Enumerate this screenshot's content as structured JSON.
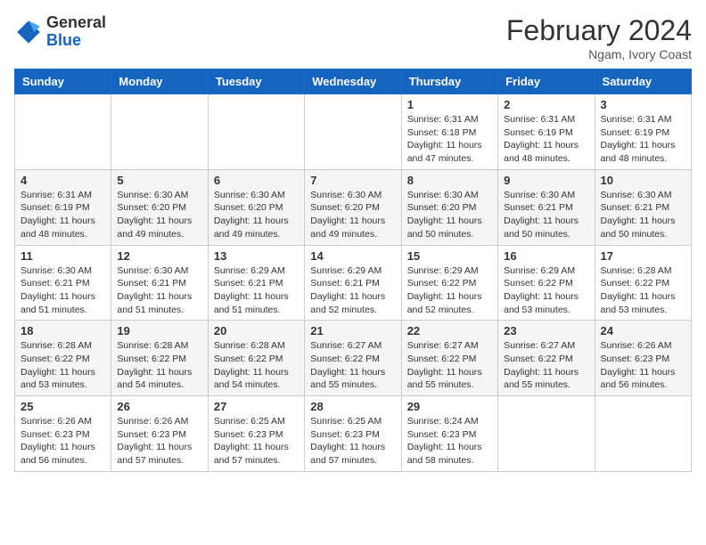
{
  "header": {
    "logo_general": "General",
    "logo_blue": "Blue",
    "month_title": "February 2024",
    "subtitle": "Ngam, Ivory Coast"
  },
  "columns": [
    "Sunday",
    "Monday",
    "Tuesday",
    "Wednesday",
    "Thursday",
    "Friday",
    "Saturday"
  ],
  "weeks": [
    [
      {
        "day": "",
        "info": ""
      },
      {
        "day": "",
        "info": ""
      },
      {
        "day": "",
        "info": ""
      },
      {
        "day": "",
        "info": ""
      },
      {
        "day": "1",
        "info": "Sunrise: 6:31 AM\nSunset: 6:18 PM\nDaylight: 11 hours and 47 minutes."
      },
      {
        "day": "2",
        "info": "Sunrise: 6:31 AM\nSunset: 6:19 PM\nDaylight: 11 hours and 48 minutes."
      },
      {
        "day": "3",
        "info": "Sunrise: 6:31 AM\nSunset: 6:19 PM\nDaylight: 11 hours and 48 minutes."
      }
    ],
    [
      {
        "day": "4",
        "info": "Sunrise: 6:31 AM\nSunset: 6:19 PM\nDaylight: 11 hours and 48 minutes."
      },
      {
        "day": "5",
        "info": "Sunrise: 6:30 AM\nSunset: 6:20 PM\nDaylight: 11 hours and 49 minutes."
      },
      {
        "day": "6",
        "info": "Sunrise: 6:30 AM\nSunset: 6:20 PM\nDaylight: 11 hours and 49 minutes."
      },
      {
        "day": "7",
        "info": "Sunrise: 6:30 AM\nSunset: 6:20 PM\nDaylight: 11 hours and 49 minutes."
      },
      {
        "day": "8",
        "info": "Sunrise: 6:30 AM\nSunset: 6:20 PM\nDaylight: 11 hours and 50 minutes."
      },
      {
        "day": "9",
        "info": "Sunrise: 6:30 AM\nSunset: 6:21 PM\nDaylight: 11 hours and 50 minutes."
      },
      {
        "day": "10",
        "info": "Sunrise: 6:30 AM\nSunset: 6:21 PM\nDaylight: 11 hours and 50 minutes."
      }
    ],
    [
      {
        "day": "11",
        "info": "Sunrise: 6:30 AM\nSunset: 6:21 PM\nDaylight: 11 hours and 51 minutes."
      },
      {
        "day": "12",
        "info": "Sunrise: 6:30 AM\nSunset: 6:21 PM\nDaylight: 11 hours and 51 minutes."
      },
      {
        "day": "13",
        "info": "Sunrise: 6:29 AM\nSunset: 6:21 PM\nDaylight: 11 hours and 51 minutes."
      },
      {
        "day": "14",
        "info": "Sunrise: 6:29 AM\nSunset: 6:21 PM\nDaylight: 11 hours and 52 minutes."
      },
      {
        "day": "15",
        "info": "Sunrise: 6:29 AM\nSunset: 6:22 PM\nDaylight: 11 hours and 52 minutes."
      },
      {
        "day": "16",
        "info": "Sunrise: 6:29 AM\nSunset: 6:22 PM\nDaylight: 11 hours and 53 minutes."
      },
      {
        "day": "17",
        "info": "Sunrise: 6:28 AM\nSunset: 6:22 PM\nDaylight: 11 hours and 53 minutes."
      }
    ],
    [
      {
        "day": "18",
        "info": "Sunrise: 6:28 AM\nSunset: 6:22 PM\nDaylight: 11 hours and 53 minutes."
      },
      {
        "day": "19",
        "info": "Sunrise: 6:28 AM\nSunset: 6:22 PM\nDaylight: 11 hours and 54 minutes."
      },
      {
        "day": "20",
        "info": "Sunrise: 6:28 AM\nSunset: 6:22 PM\nDaylight: 11 hours and 54 minutes."
      },
      {
        "day": "21",
        "info": "Sunrise: 6:27 AM\nSunset: 6:22 PM\nDaylight: 11 hours and 55 minutes."
      },
      {
        "day": "22",
        "info": "Sunrise: 6:27 AM\nSunset: 6:22 PM\nDaylight: 11 hours and 55 minutes."
      },
      {
        "day": "23",
        "info": "Sunrise: 6:27 AM\nSunset: 6:22 PM\nDaylight: 11 hours and 55 minutes."
      },
      {
        "day": "24",
        "info": "Sunrise: 6:26 AM\nSunset: 6:23 PM\nDaylight: 11 hours and 56 minutes."
      }
    ],
    [
      {
        "day": "25",
        "info": "Sunrise: 6:26 AM\nSunset: 6:23 PM\nDaylight: 11 hours and 56 minutes."
      },
      {
        "day": "26",
        "info": "Sunrise: 6:26 AM\nSunset: 6:23 PM\nDaylight: 11 hours and 57 minutes."
      },
      {
        "day": "27",
        "info": "Sunrise: 6:25 AM\nSunset: 6:23 PM\nDaylight: 11 hours and 57 minutes."
      },
      {
        "day": "28",
        "info": "Sunrise: 6:25 AM\nSunset: 6:23 PM\nDaylight: 11 hours and 57 minutes."
      },
      {
        "day": "29",
        "info": "Sunrise: 6:24 AM\nSunset: 6:23 PM\nDaylight: 11 hours and 58 minutes."
      },
      {
        "day": "",
        "info": ""
      },
      {
        "day": "",
        "info": ""
      }
    ]
  ]
}
